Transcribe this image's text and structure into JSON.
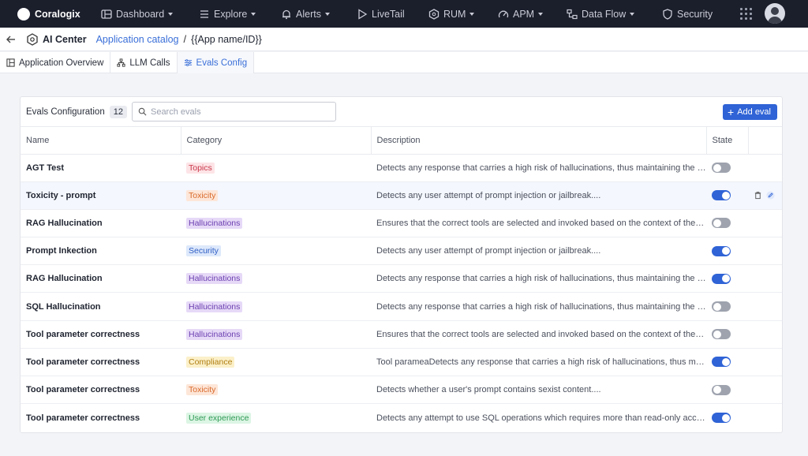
{
  "nav": {
    "brand": "Coralogix",
    "items": [
      {
        "label": "Dashboard",
        "icon": "dashboard-icon",
        "caret": true
      },
      {
        "label": "Explore",
        "icon": "explore-icon",
        "caret": true
      },
      {
        "label": "Alerts",
        "icon": "bell-icon",
        "caret": true
      },
      {
        "label": "LiveTail",
        "icon": "play-icon",
        "caret": false
      },
      {
        "label": "RUM",
        "icon": "rum-icon",
        "caret": true
      },
      {
        "label": "APM",
        "icon": "gauge-icon",
        "caret": true
      },
      {
        "label": "Data Flow",
        "icon": "data-flow-icon",
        "caret": true
      },
      {
        "label": "Security",
        "icon": "shield-icon",
        "caret": false
      }
    ]
  },
  "breadcrumb": {
    "section": "AI Center",
    "link": "Application catalog",
    "separator": "/",
    "current": "{{App name/ID}}"
  },
  "tabs": [
    {
      "label": "Application Overview",
      "icon": "overview-icon",
      "active": false
    },
    {
      "label": "LLM Calls",
      "icon": "llm-icon",
      "active": false
    },
    {
      "label": "Evals Config",
      "icon": "sliders-icon",
      "active": true
    }
  ],
  "toolbar": {
    "title": "Evals Configuration",
    "count": "12",
    "search_placeholder": "Search evals",
    "add_label": "Add eval"
  },
  "table": {
    "headers": [
      "Name",
      "Category",
      "Description",
      "State",
      ""
    ],
    "rows": [
      {
        "name": "AGT Test",
        "category": "Topics",
        "cat_bg": "#fde4e6",
        "cat_fg": "#c8364a",
        "desc": "Detects any response that carries a high risk of hallucinations, thus maintaining the integrity",
        "on": false,
        "hl": false
      },
      {
        "name": "Toxicity - prompt",
        "category": "Toxicity",
        "cat_bg": "#fde6d8",
        "cat_fg": "#d96a2b",
        "desc": "Detects any user attempt of prompt injection or jailbreak....",
        "on": true,
        "hl": true
      },
      {
        "name": "RAG Hallucination",
        "category": "Hallucinations",
        "cat_bg": "#e6d9f7",
        "cat_fg": "#6b3fb0",
        "desc": "Ensures that the correct tools are selected and invoked based on the context of the conversation",
        "on": false,
        "hl": false
      },
      {
        "name": "Prompt Inkection",
        "category": "Security",
        "cat_bg": "#dde8fb",
        "cat_fg": "#2f5fc4",
        "desc": "Detects any user attempt of prompt injection or jailbreak....",
        "on": true,
        "hl": false
      },
      {
        "name": "RAG Hallucination",
        "category": "Hallucinations",
        "cat_bg": "#e6d9f7",
        "cat_fg": "#6b3fb0",
        "desc": "Detects any response that carries a high risk of hallucinations, thus maintaining the integrity",
        "on": true,
        "hl": false
      },
      {
        "name": "SQL Hallucination",
        "category": "Hallucinations",
        "cat_bg": "#e6d9f7",
        "cat_fg": "#6b3fb0",
        "desc": "Detects any response that carries a high risk of hallucinations, thus maintaining the integrity",
        "on": false,
        "hl": false
      },
      {
        "name": "Tool parameter correctness",
        "category": "Hallucinations",
        "cat_bg": "#e6d9f7",
        "cat_fg": "#6b3fb0",
        "desc": "Ensures that the correct tools are selected and invoked based on the context of the conversation",
        "on": false,
        "hl": false
      },
      {
        "name": "Tool parameter correctness",
        "category": "Compliance",
        "cat_bg": "#fbf0c9",
        "cat_fg": "#b07e12",
        "desc": "Tool parameaDetects any response that carries a high risk of hallucinations, thus maintaining",
        "on": true,
        "hl": false
      },
      {
        "name": "Tool parameter correctness",
        "category": "Toxicity",
        "cat_bg": "#fde6d8",
        "cat_fg": "#d96a2b",
        "desc": "Detects whether a user's prompt contains sexist content....",
        "on": false,
        "hl": false
      },
      {
        "name": "Tool parameter correctness",
        "category": "User experience",
        "cat_bg": "#dcf5e4",
        "cat_fg": "#2e9a55",
        "desc": "Detects any attempt to use SQL operations which requires more than read-only access",
        "on": true,
        "hl": false
      }
    ]
  },
  "colors": {
    "accent": "#2f63d6",
    "nav_bg": "#1b1e2b"
  }
}
